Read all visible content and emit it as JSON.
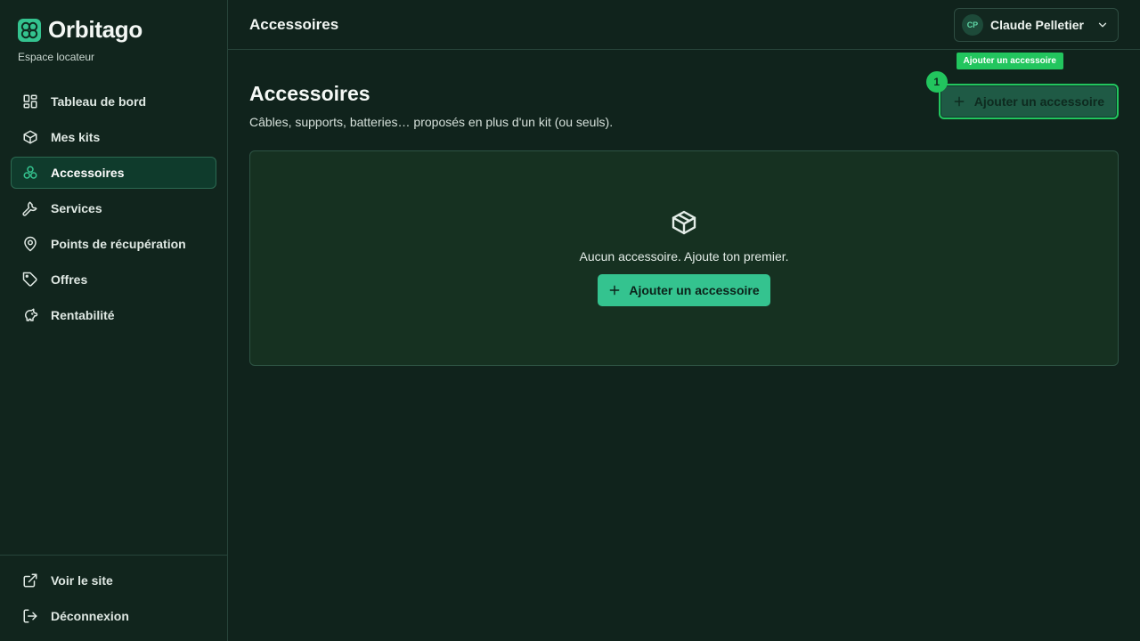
{
  "brand": {
    "name": "Orbitago",
    "subtitle": "Espace locateur"
  },
  "sidebar": {
    "items": [
      {
        "label": "Tableau de bord",
        "icon": "dashboard-icon"
      },
      {
        "label": "Mes kits",
        "icon": "box-icon"
      },
      {
        "label": "Accessoires",
        "icon": "accessories-icon",
        "active": true
      },
      {
        "label": "Services",
        "icon": "wrench-icon"
      },
      {
        "label": "Points de récupération",
        "icon": "map-pin-icon"
      },
      {
        "label": "Offres",
        "icon": "tag-icon"
      },
      {
        "label": "Rentabilité",
        "icon": "piggy-bank-icon"
      }
    ],
    "bottom": [
      {
        "label": "Voir le site",
        "icon": "external-link-icon"
      },
      {
        "label": "Déconnexion",
        "icon": "logout-icon"
      }
    ]
  },
  "topbar": {
    "title": "Accessoires",
    "user_initials": "CP",
    "user_name": "Claude Pelletier"
  },
  "page": {
    "title": "Accessoires",
    "description": "Câbles, supports, batteries… proposés en plus d'un kit (ou seuls).",
    "add_button_label": "Ajouter un accessoire",
    "tooltip": "Ajouter un accessoire",
    "badge": "1"
  },
  "empty_state": {
    "icon": "package-icon",
    "text": "Aucun accessoire. Ajoute ton premier.",
    "button_label": "Ajouter un accessoire"
  },
  "colors": {
    "accent": "#34c38f",
    "highlight": "#22c55e",
    "background": "#10231c"
  }
}
